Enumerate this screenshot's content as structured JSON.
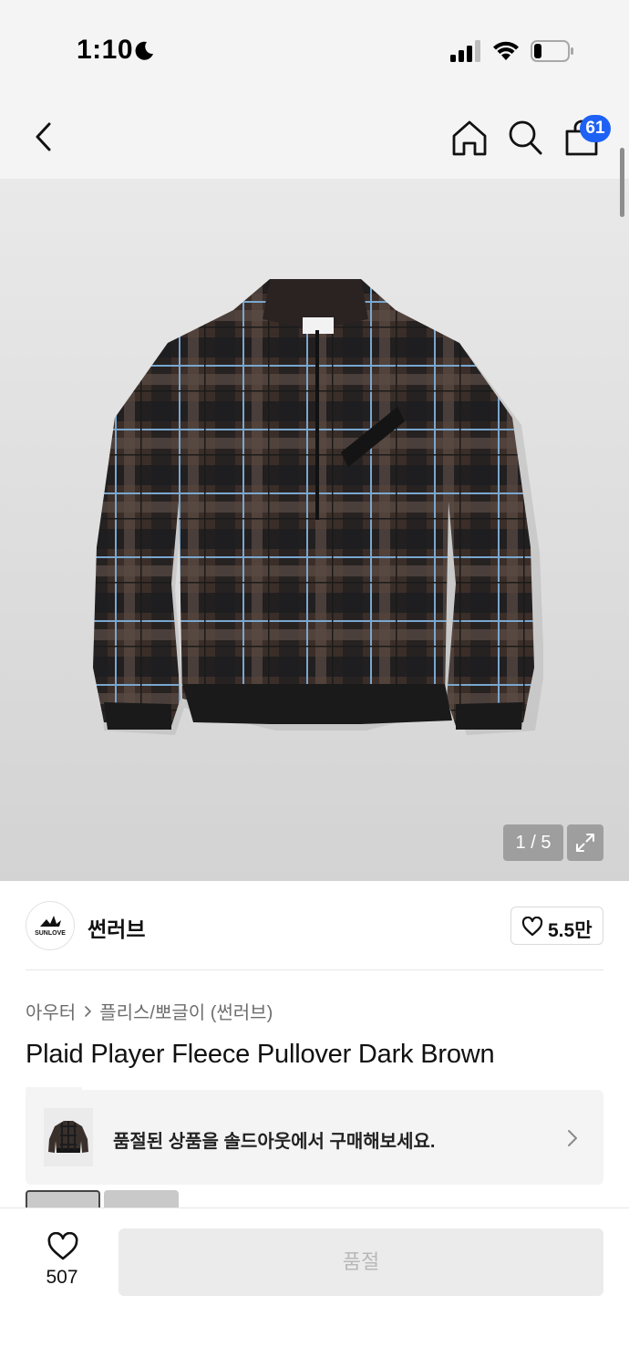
{
  "status_bar": {
    "time": "1:10"
  },
  "nav": {
    "back_icon": "chevron-left-icon",
    "home_icon": "home-icon",
    "search_icon": "search-icon",
    "cart_icon": "shopping-bag-icon",
    "cart_badge": "61",
    "badge_color": "#1e62f5"
  },
  "gallery": {
    "pager": "1 / 5",
    "expand_icon": "expand-icon"
  },
  "brand": {
    "logo_text": "SUNLOVE",
    "name": "썬러브",
    "likes": "5.5만"
  },
  "product": {
    "breadcrumb": [
      "아우터",
      "플리스/뽀글이 (썬러브)"
    ],
    "title": "Plaid Player Fleece Pullover Dark Brown"
  },
  "soldout_banner": {
    "text": "품절된 상품을 솔드아웃에서 구매해보세요."
  },
  "bottom_bar": {
    "wish_count": "507",
    "buy_label": "품절"
  }
}
